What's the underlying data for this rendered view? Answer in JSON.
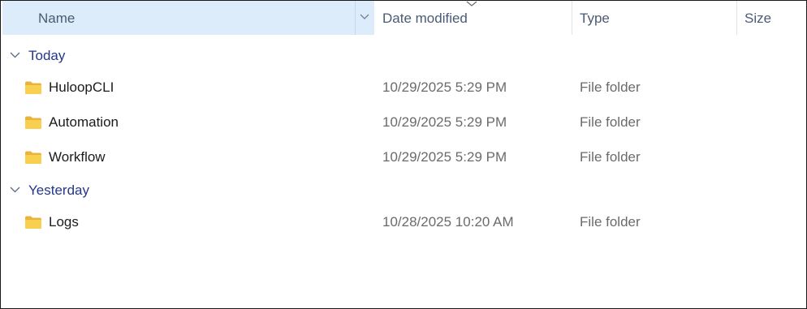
{
  "columns": {
    "name": "Name",
    "date_modified": "Date modified",
    "type": "Type",
    "size": "Size"
  },
  "groups": [
    {
      "label": "Today",
      "items": [
        {
          "name": "HuloopCLI",
          "date": "10/29/2025 5:29 PM",
          "type": "File folder",
          "icon": "folder-icon"
        },
        {
          "name": "Automation",
          "date": "10/29/2025 5:29 PM",
          "type": "File folder",
          "icon": "folder-icon"
        },
        {
          "name": "Workflow",
          "date": "10/29/2025 5:29 PM",
          "type": "File folder",
          "icon": "folder-icon"
        }
      ]
    },
    {
      "label": "Yesterday",
      "items": [
        {
          "name": "Logs",
          "date": "10/28/2025 10:20 AM",
          "type": "File folder",
          "icon": "folder-icon"
        }
      ]
    }
  ],
  "colors": {
    "header_selected_bg": "#dcecfb",
    "group_text": "#24378a",
    "folder_yellow": "#f8cf4f"
  }
}
